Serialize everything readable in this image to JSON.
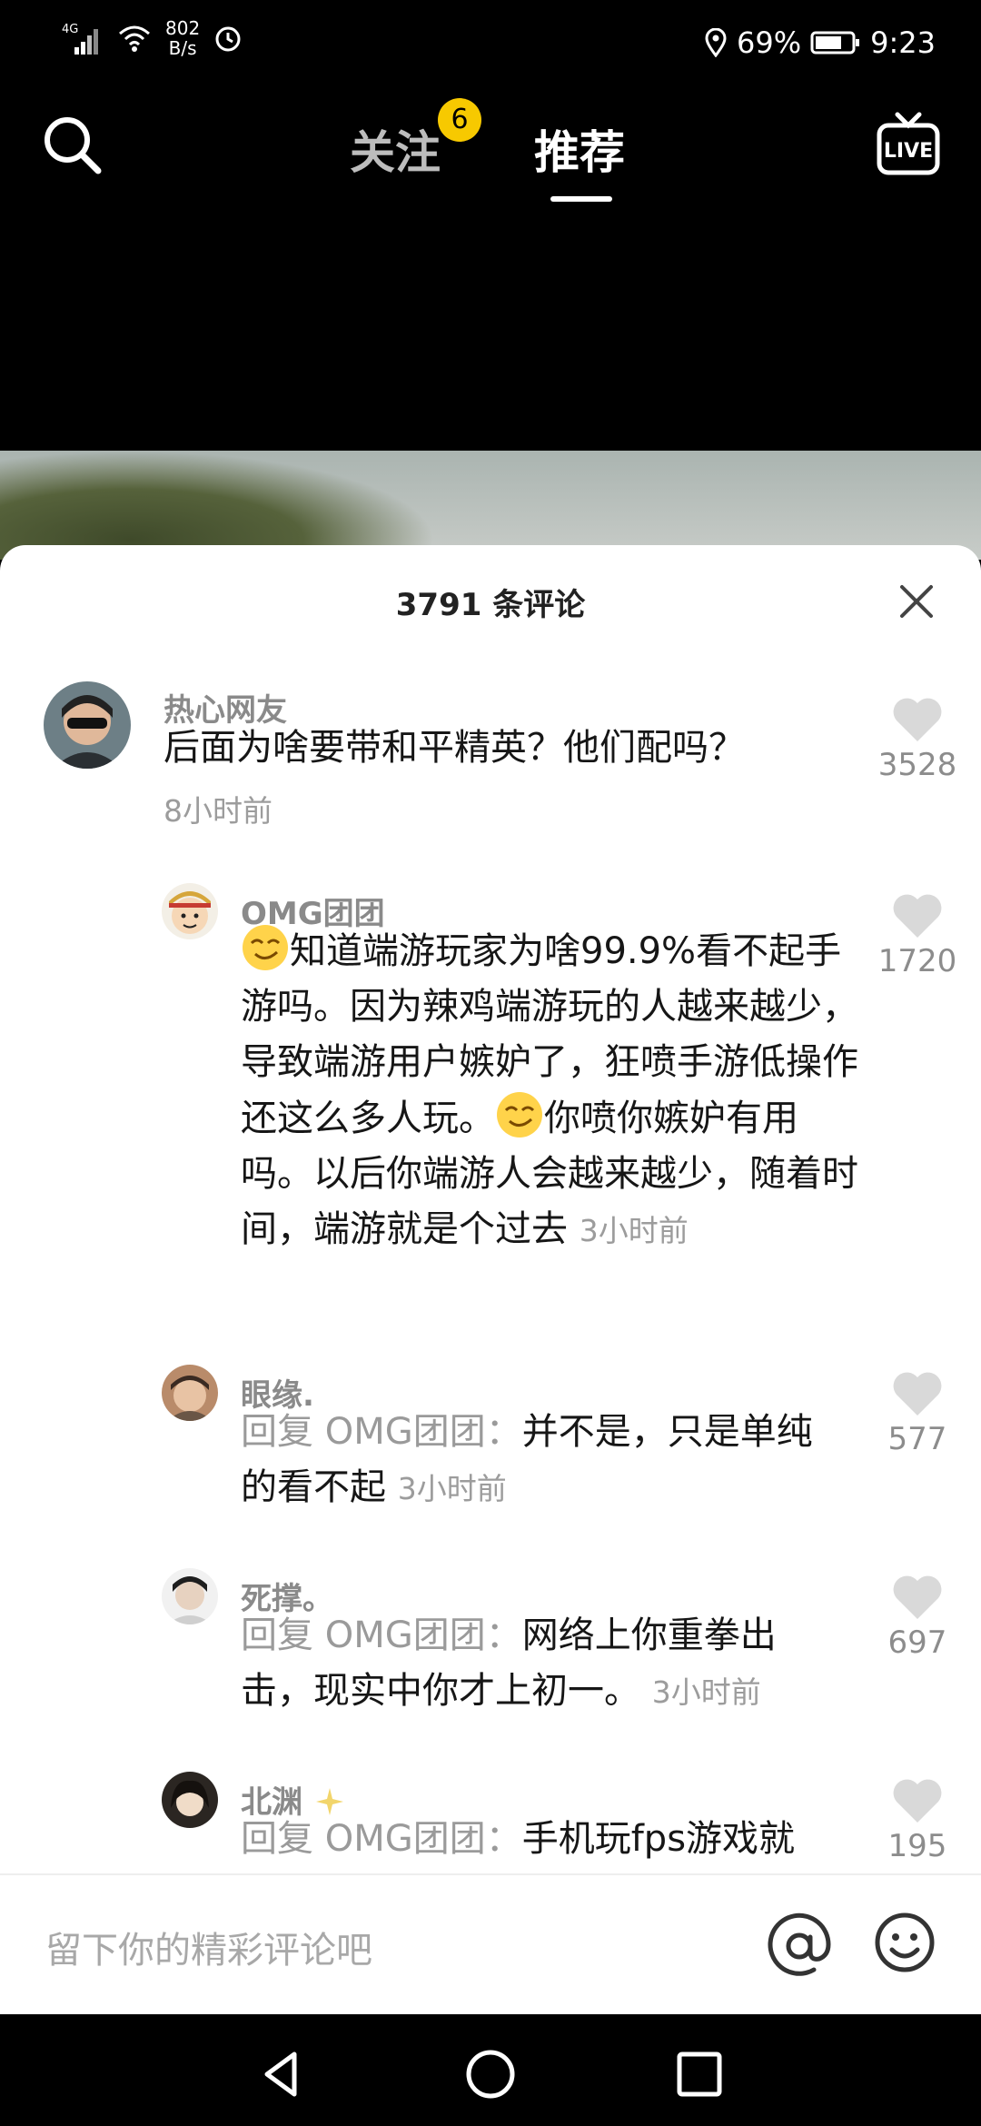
{
  "status_bar": {
    "network": "4G",
    "speed_value": "802",
    "speed_unit": "B/s",
    "battery": "69%",
    "time": "9:23"
  },
  "top_nav": {
    "follow_tab": "关注",
    "follow_badge": "6",
    "recommend_tab": "推荐",
    "live_label": "LIVE"
  },
  "comments_sheet": {
    "title": "3791 条评论",
    "comments": [
      {
        "username": "热心网友",
        "text": "后面为啥要带和平精英？他们配吗？",
        "time": "8小时前",
        "likes": "3528"
      },
      {
        "username": "OMG团团",
        "text_part1": "知道端游玩家为啥99.9%看不起手游吗。因为辣鸡端游玩的人越来越少，导致端游用户嫉妒了，狂喷手游低操作还这么多人玩。",
        "text_part2": "你喷你嫉妒有用吗。以后你端游人会越来越少，随着时间，端游就是个过去",
        "time": "3小时前",
        "likes": "1720"
      },
      {
        "username": "眼缘.",
        "reply_prefix": "回复 OMG团团：",
        "text": "并不是，只是单纯的看不起",
        "time": "3小时前",
        "likes": "577"
      },
      {
        "username": "死撑。",
        "reply_prefix": "回复 OMG团团：",
        "text": "网络上你重拳出击，现实中你才上初一。",
        "time": "3小时前",
        "likes": "697"
      },
      {
        "username": "北渊",
        "reply_prefix": "回复 OMG团团：",
        "text": "手机玩fps游戏就",
        "likes": "195"
      }
    ]
  },
  "input_bar": {
    "placeholder": "留下你的精彩评论吧"
  },
  "colors": {
    "badge": "#f7c900",
    "sheet_bg": "#ffffff",
    "meta_gray": "#9c9c9c"
  },
  "icons": [
    "search-icon",
    "live-icon",
    "close-icon",
    "heart-icon",
    "at-icon",
    "emoji-icon",
    "back-icon",
    "home-icon",
    "recents-icon"
  ]
}
